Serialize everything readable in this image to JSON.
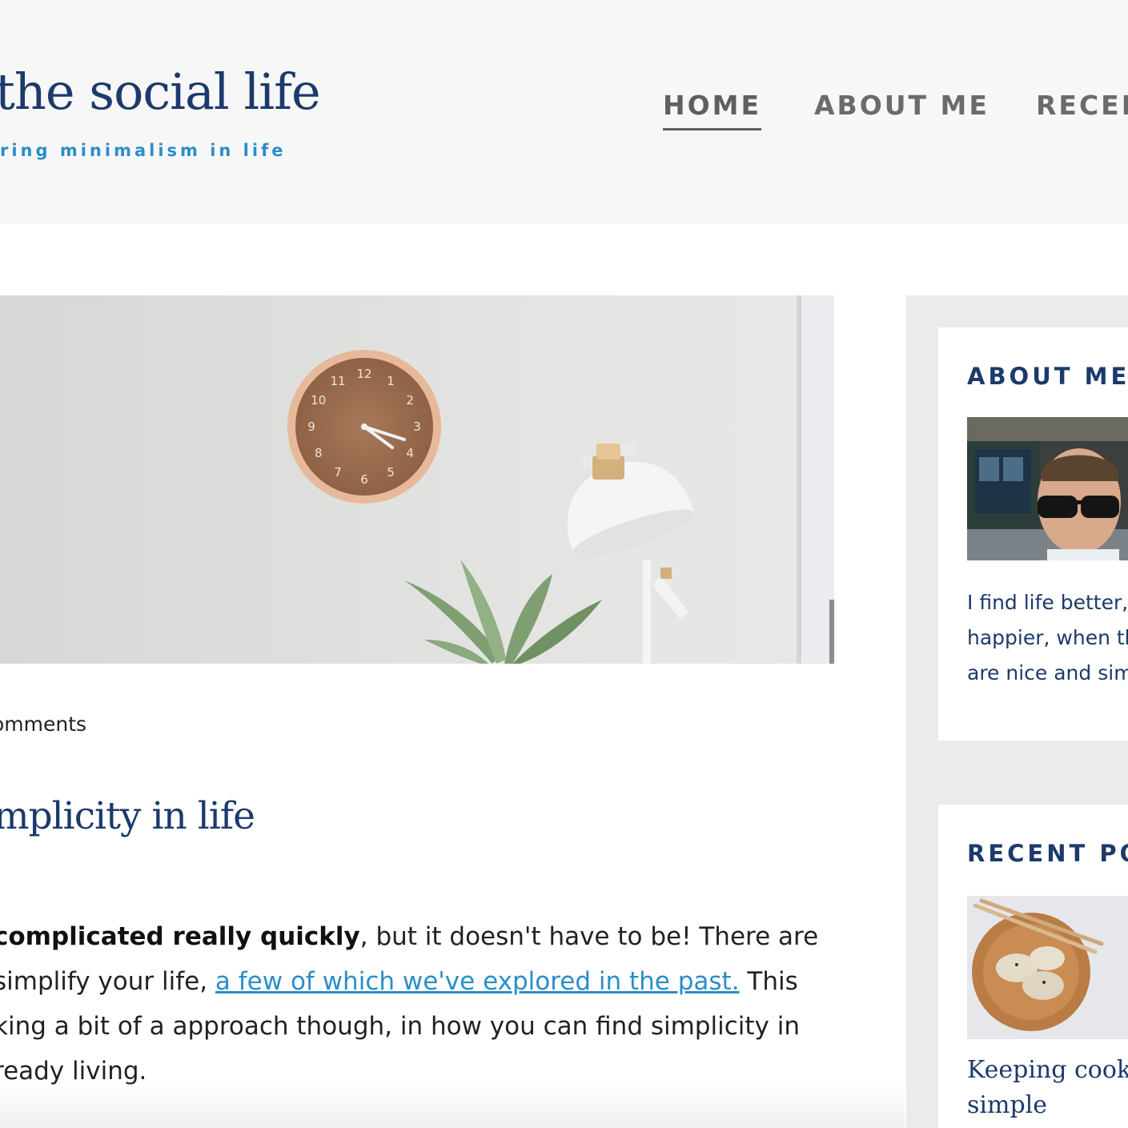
{
  "header": {
    "site_title": "the social life",
    "tagline": "ring minimalism in life",
    "nav": [
      {
        "label": "HOME",
        "active": true
      },
      {
        "label": "ABOUT ME",
        "active": false
      },
      {
        "label": "RECEN",
        "active": false
      }
    ]
  },
  "hero": {
    "image": "clock-lamp-plant-photo",
    "clock_numbers": [
      "12",
      "1",
      "2",
      "3",
      "4",
      "5",
      "6",
      "7",
      "8",
      "9",
      "10",
      "11"
    ]
  },
  "post": {
    "meta": "omments",
    "title": "mplicity in life",
    "paragraph": {
      "line1_bold": "complicated really quickly",
      "line1_rest": ", but it doesn't have to be! There are",
      "line2_start": " simplify your life, ",
      "line2_link": "a few of which we've explored in the past.",
      "line2_end": " This",
      "line3": "king a bit of a approach though, in how you can find simplicity in",
      "line4": "ready living."
    }
  },
  "sidebar": {
    "about": {
      "title": "ABOUT ME",
      "image": "author-avatar-photo",
      "text_lines": [
        "I find life better,",
        "happier, when th",
        "are nice and simp"
      ]
    },
    "recent": {
      "title": "RECENT PO",
      "image": "dumplings-bowl-photo",
      "post_title_lines": [
        "Keeping cook",
        "simple"
      ]
    }
  },
  "colors": {
    "navy": "#1c3a6b",
    "link_blue": "#2b8ec9",
    "header_bg": "#f7f7f7",
    "sidebar_bg": "#ebebeb"
  }
}
